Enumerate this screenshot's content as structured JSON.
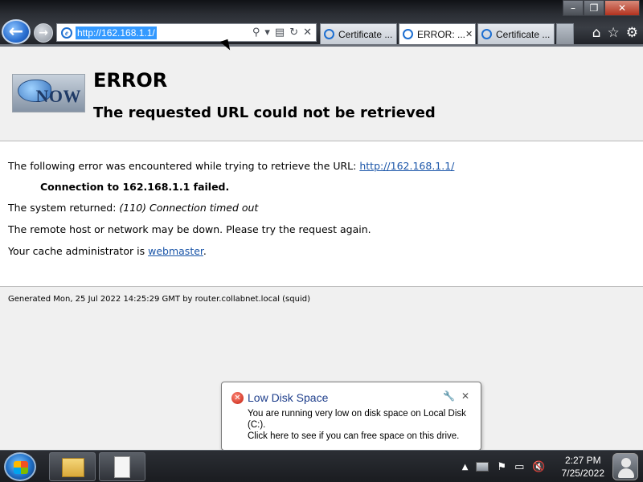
{
  "browser": {
    "address_url": "http://162.168.1.1/",
    "tabs": [
      {
        "label": "Certificate ..."
      },
      {
        "label": "ERROR: ..."
      },
      {
        "label": "Certificate ..."
      }
    ],
    "window_buttons": {
      "min": "–",
      "max": "❐",
      "close": "✕"
    },
    "right_icons": [
      "home-icon",
      "star-icon",
      "gear-icon"
    ]
  },
  "page": {
    "logo_text": "NOW",
    "title": "ERROR",
    "subtitle": "The requested URL could not be retrieved",
    "line1_prefix": "The following error was encountered while trying to retrieve the URL: ",
    "line1_link": "http://162.168.1.1/",
    "line2": "Connection to 162.168.1.1 failed.",
    "line3_prefix": "The system returned: ",
    "line3_italic": "(110) Connection timed out",
    "line4": "The remote host or network may be down. Please try the request again.",
    "line5_prefix": "Your cache administrator is ",
    "line5_link": "webmaster",
    "line5_suffix": ".",
    "footer": "Generated Mon, 25 Jul 2022 14:25:29 GMT by router.collabnet.local (squid)"
  },
  "notification": {
    "title": "Low Disk Space",
    "body_line1": "You are running very low on disk space on Local Disk (C:).",
    "body_line2": "Click here to see if you can free space on this drive."
  },
  "taskbar": {
    "time": "2:27 PM",
    "date": "7/25/2022"
  }
}
